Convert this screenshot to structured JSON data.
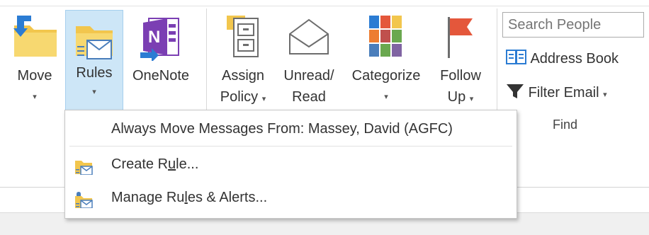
{
  "ribbon": {
    "buttons": {
      "move": {
        "label": "Move",
        "icon": "folder-move-icon"
      },
      "rules": {
        "label": "Rules",
        "icon": "rules-icon"
      },
      "onenote": {
        "label": "OneNote",
        "icon": "onenote-icon"
      },
      "assign_policy": {
        "line1": "Assign",
        "line2": "Policy",
        "icon": "policy-cabinet-icon"
      },
      "unread_read": {
        "line1": "Unread/",
        "line2": "Read",
        "icon": "envelope-icon"
      },
      "categorize": {
        "label": "Categorize",
        "icon": "categorize-icon"
      },
      "follow_up": {
        "line1": "Follow",
        "line2": "Up",
        "icon": "flag-icon"
      }
    },
    "find_group": {
      "search_placeholder": "Search People",
      "address_book": "Address Book",
      "filter_email": "Filter Email",
      "group_label": "Find"
    },
    "caret": "▾",
    "colors": {
      "rules_highlight": "#cde6f7",
      "folder": "#f2c64d",
      "onenote": "#7b3fb3",
      "flag": "#e4573b"
    }
  },
  "rules_menu": {
    "always_move": "Always Move Messages From: Massey, David (AGFC)",
    "create_rule": {
      "pre": "Create R",
      "underlined": "u",
      "post": "le..."
    },
    "manage_rules": {
      "pre": "Manage Ru",
      "underlined": "l",
      "post": "es & Alerts..."
    }
  }
}
